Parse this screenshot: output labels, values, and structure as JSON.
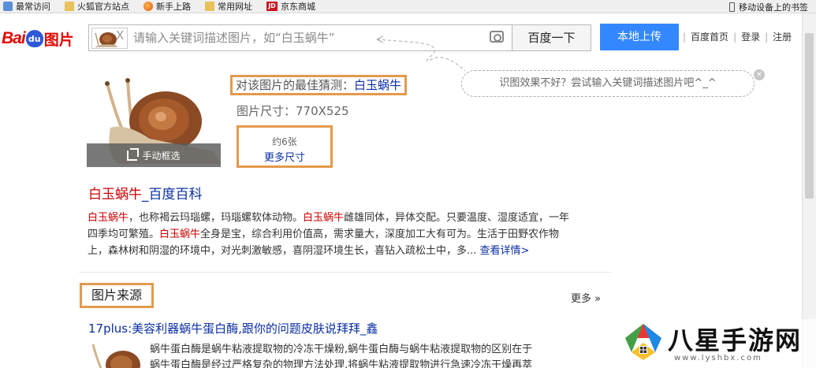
{
  "bookmarks": {
    "items": [
      {
        "label": "最常访问",
        "icon": "star-icon"
      },
      {
        "label": "火狐官方站点",
        "icon": "folder-icon"
      },
      {
        "label": "新手上路",
        "icon": "firefox-icon"
      },
      {
        "label": "常用网址",
        "icon": "folder-icon"
      },
      {
        "label": "京东商城",
        "icon": "jd-icon",
        "icon_text": "JD"
      }
    ],
    "mobile": "移动设备上的书签"
  },
  "header": {
    "logo": {
      "bai": "Bai",
      "du": "du",
      "tupian": "图片"
    },
    "thumb_close": "X",
    "search_placeholder": "请输入关键词描述图片，如“白玉蜗牛”",
    "search_button": "百度一下",
    "upload_button": "本地上传",
    "links": [
      "百度首页",
      "登录",
      "注册"
    ]
  },
  "guess_tip": {
    "text": "识图效果不好？尝试输入关键词描述图片吧^_^",
    "close": "×"
  },
  "result": {
    "crop_label": "手动框选",
    "best_guess_prefix": "对该图片的最佳猜测：",
    "best_guess_keyword": "白玉蜗牛",
    "image_size": "图片尺寸：770X525",
    "count": "约6张",
    "more_sizes": "更多尺寸"
  },
  "baike": {
    "title_kw": "白玉蜗牛",
    "title_rest": "_百度百科",
    "desc_lines": [
      [
        {
          "t": "白玉蜗牛",
          "hl": true
        },
        {
          "t": "，也称褐云玛瑙螺，玛瑙螺软体动物。"
        },
        {
          "t": "白玉蜗牛",
          "hl": true
        },
        {
          "t": "雌雄同体，异体交配。只要温度、湿度适宜，一年"
        }
      ],
      [
        {
          "t": "四季均可繁殖。"
        },
        {
          "t": "白玉蜗牛",
          "hl": true
        },
        {
          "t": "全身是宝，综合利用价值高，需求量大，深度加工大有可为。生活于田野农作物"
        }
      ],
      [
        {
          "t": "上，森林树和阴湿的环境中，对光刺激敏感，喜阴湿环境生长，喜钻入疏松土中，多..."
        }
      ]
    ],
    "more": "查看详情>"
  },
  "source": {
    "title": "图片来源",
    "more": "更多 »",
    "link": "17plus:美容利器蜗牛蛋白酶,跟你的问题皮肤说拜拜_鑫",
    "desc_lines": [
      "蜗牛蛋白酶是蜗牛粘液提取物的冷冻干燥粉,蜗牛蛋白酶与蜗牛粘液提取物的区别在于",
      "蜗牛蛋白酶是经过严格复杂的物理方法处理,将蜗牛粘液提取物进行急速冷冻干燥再萃"
    ]
  },
  "watermark": {
    "text": "八星手游网",
    "url": "www.lyshbx.com"
  }
}
